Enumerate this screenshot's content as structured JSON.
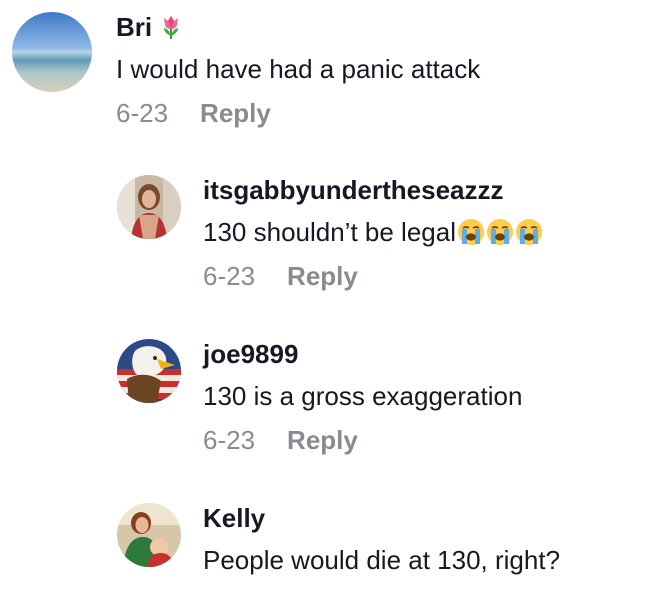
{
  "comments": [
    {
      "username": "Bri",
      "text": "I would have had a panic attack",
      "date": "6-23",
      "reply_label": "Reply"
    },
    {
      "username": "itsgabbyundertheseazzz",
      "text": "130 shouldn’t be legal",
      "date": "6-23",
      "reply_label": "Reply"
    },
    {
      "username": "joe9899",
      "text": "130 is a gross exaggeration",
      "date": "6-23",
      "reply_label": "Reply"
    },
    {
      "username": "Kelly",
      "text": "People would die at 130, right?"
    }
  ],
  "icons": {
    "username_badge": "tulip-icon",
    "reaction_emoji": "loudly-crying-face-icon"
  },
  "colors": {
    "text": "#161823",
    "muted": "#8a8b91",
    "background": "#ffffff"
  }
}
